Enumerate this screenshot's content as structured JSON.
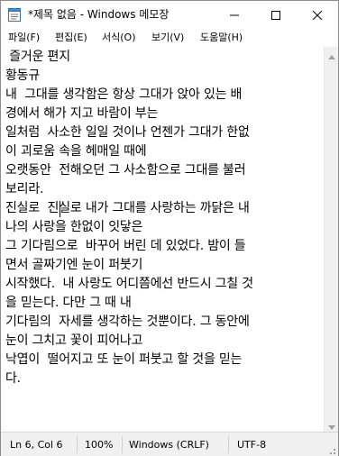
{
  "window": {
    "title": "*제목 없음 - Windows 메모장"
  },
  "menu": {
    "items": [
      "파일(F)",
      "편집(E)",
      "서식(O)",
      "보기(V)",
      "도움말(H)"
    ]
  },
  "editor": {
    "lines": [
      " 즐거운 편지",
      "황동규",
      "내  그대를 생각함은 항상 그대가 앉아 있는 배",
      "경에서 해가 지고 바람이 부는",
      "일처럼  사소한 일일 것이나 언젠가 그대가 한없",
      "이 괴로움 속을 헤매일 때에",
      "오랫동안  전해오던 그 사소함으로 그대를 불러",
      "보리라.",
      "진실로  진실로 내가 그대를 사랑하는 까닭은 내",
      "나의 사랑을 한없이 잇닿은",
      "그 기다림으로  바꾸어 버린 데 있었다. 밤이 들",
      "면서 골짜기엔 눈이 퍼붓기",
      "시작했다.  내 사랑도 어디쯤에선 반드시 그칠 것",
      "을 믿는다. 다만 그 때 내",
      "기다림의  자세를 생각하는 것뿐이다. 그 동안에",
      "눈이 그치고 꽃이 피어나고",
      "낙엽이  떨어지고 또 눈이 퍼붓고 할 것을 믿는",
      "다."
    ]
  },
  "status": {
    "position": "Ln 6, Col 6",
    "zoom": "100%",
    "line_ending": "Windows (CRLF)",
    "encoding": "UTF-8"
  },
  "icons": {
    "app": "notepad-icon",
    "minimize": "minimize-icon",
    "maximize": "maximize-icon",
    "close": "close-icon"
  }
}
